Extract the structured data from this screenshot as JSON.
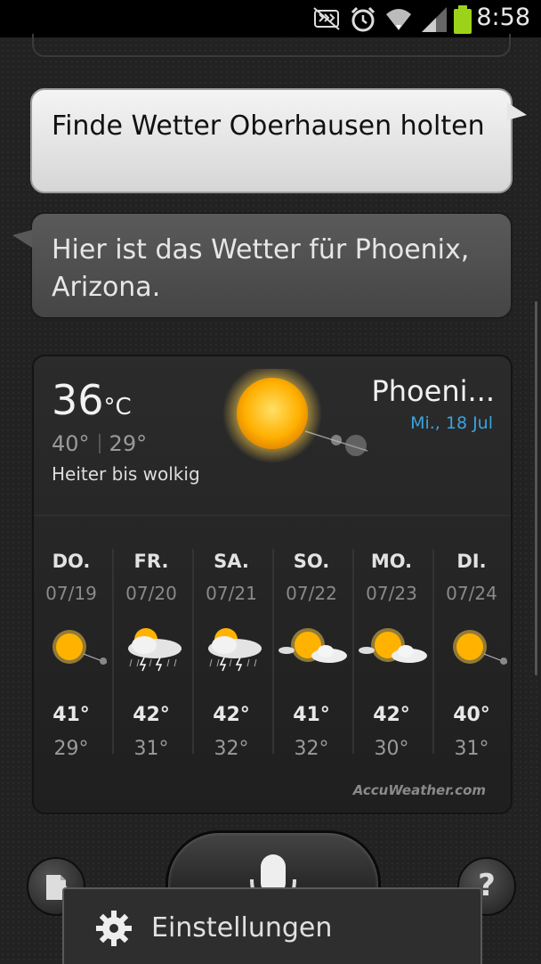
{
  "status_bar": {
    "time": "8:58",
    "icons": [
      "mute-icon",
      "alarm-icon",
      "wifi-icon",
      "signal-icon",
      "battery-icon"
    ],
    "battery_color": "#9cd31a"
  },
  "conversation": {
    "user_message": "Finde Wetter Oberhausen holten",
    "assistant_message": "Hier ist das Wetter für Phoenix, Arizona."
  },
  "weather": {
    "current_temp": "36",
    "unit": "°C",
    "high": "40°",
    "low": "29°",
    "condition": "Heiter bis wolkig",
    "city": "Phoeni...",
    "date": "Mi., 18 Jul",
    "date_color": "#39a3e0",
    "current_icon": "sun-icon",
    "forecast": [
      {
        "day": "DO.",
        "date": "07/19",
        "hi": "41°",
        "lo": "29°",
        "icon": "sunny-icon"
      },
      {
        "day": "FR.",
        "date": "07/20",
        "hi": "42°",
        "lo": "31°",
        "icon": "thunderstorm-icon"
      },
      {
        "day": "SA.",
        "date": "07/21",
        "hi": "42°",
        "lo": "32°",
        "icon": "thunderstorm-icon"
      },
      {
        "day": "SO.",
        "date": "07/22",
        "hi": "41°",
        "lo": "32°",
        "icon": "partly-cloudy-icon"
      },
      {
        "day": "MO.",
        "date": "07/23",
        "hi": "42°",
        "lo": "30°",
        "icon": "partly-cloudy-icon"
      },
      {
        "day": "DI.",
        "date": "07/24",
        "hi": "40°",
        "lo": "31°",
        "icon": "sunny-icon"
      }
    ],
    "provider": "AccuWeather.com"
  },
  "bottom_bar": {
    "help_label": "?",
    "menu_item": "Einstellungen"
  }
}
